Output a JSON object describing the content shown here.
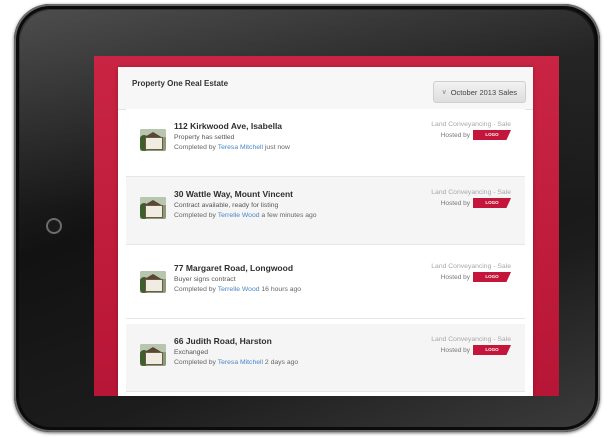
{
  "header": {
    "title": "Property One Real Estate",
    "sales_button_label": "October 2013 Sales"
  },
  "listings": [
    {
      "address": "112 Kirkwood Ave, Isabella",
      "status": "Property has settled",
      "completed_prefix": "Completed by",
      "agent": "Teresa Mitchell",
      "time": "just now",
      "service": "Land Conveyancing - Sale",
      "hosted_label": "Hosted by",
      "host_badge": "LOGO"
    },
    {
      "address": "30 Wattle Way, Mount Vincent",
      "status": "Contract available, ready for listing",
      "completed_prefix": "Completed by",
      "agent": "Terrelle Wood",
      "time": "a few minutes ago",
      "service": "Land Conveyancing - Sale",
      "hosted_label": "Hosted by",
      "host_badge": "LOGO"
    },
    {
      "address": "77 Margaret Road, Longwood",
      "status": "Buyer signs contract",
      "completed_prefix": "Completed by",
      "agent": "Terrelle Wood",
      "time": "16 hours ago",
      "service": "Land Conveyancing - Sale",
      "hosted_label": "Hosted by",
      "host_badge": "LOGO"
    },
    {
      "address": "66 Judith Road, Harston",
      "status": "Exchanged",
      "completed_prefix": "Completed by",
      "agent": "Teresa Mitchell",
      "time": "2 days ago",
      "service": "Land Conveyancing - Sale",
      "hosted_label": "Hosted by",
      "host_badge": "LOGO"
    }
  ],
  "icons": {
    "sales_button": "chevron-down-icon",
    "listing_thumb": "house-photo-icon",
    "device_button": "home-button-icon"
  },
  "colors": {
    "brand_red": "#c4163a",
    "screen_background": "#c92443",
    "link_blue": "#4a86c7",
    "panel_background": "#ffffff"
  }
}
